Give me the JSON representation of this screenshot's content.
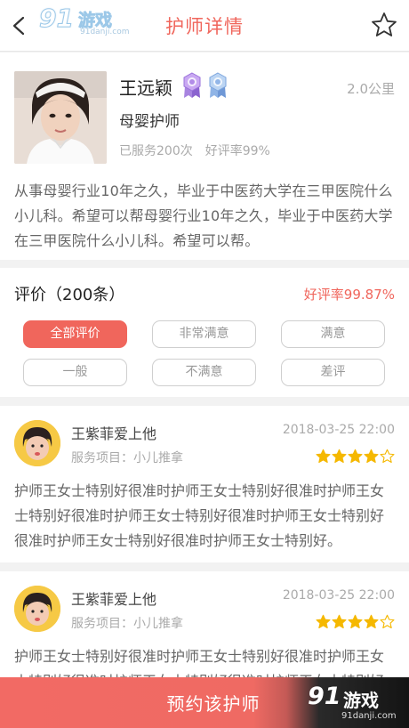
{
  "header": {
    "title": "护师详情",
    "logo_num": "91",
    "logo_text": "游戏",
    "logo_url": "91danji.com"
  },
  "nurse": {
    "name": "王远颖",
    "distance": "2.0公里",
    "role": "母婴护师",
    "served": "已服务200次",
    "good_rate": "好评率99%",
    "intro": "从事母婴行业10年之久，毕业于中医药大学在三甲医院什么小儿科。希望可以帮母婴行业10年之久，毕业于中医药大学在三甲医院什么小儿科。希望可以帮。"
  },
  "reviews_summary": {
    "title": "评价（200条）",
    "rate": "好评率99.87%",
    "filters": [
      "全部评价",
      "非常满意",
      "满意",
      "一般",
      "不满意",
      "差评"
    ],
    "active_filter": "全部评价"
  },
  "reviews": [
    {
      "name": "王紫菲爱上他",
      "date": "2018-03-25 22:00",
      "service": "服务项目：小儿推拿",
      "stars": 4,
      "body": "护师王女士特别好很准时护师王女士特别好很准时护师王女士特别好很准时护师王女士特别好很准时护师王女士特别好很准时护师王女士特别好很准时护师王女士特别好。"
    },
    {
      "name": "王紫菲爱上他",
      "date": "2018-03-25 22:00",
      "service": "服务项目：小儿推拿",
      "stars": 4,
      "body": "护师王女士特别好很准时护师王女士特别好很准时护师王女士特别好很准时护师王女士特别好很准时护师王女士特别好很准时护师王女士特别好很准时护师王女士特别好。"
    }
  ],
  "bottom": {
    "cta": "预约该护师",
    "watermark_num": "91",
    "watermark_text": "游戏",
    "watermark_url": "91danji.com"
  },
  "colors": {
    "accent": "#f0665c",
    "star": "#f5b800"
  }
}
